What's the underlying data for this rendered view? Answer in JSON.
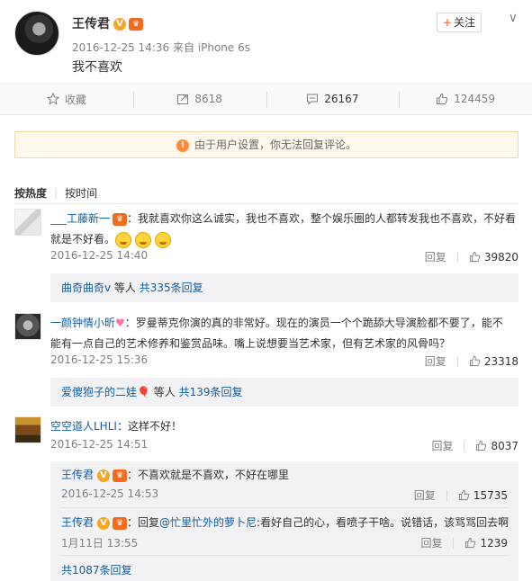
{
  "post": {
    "author": "王传君",
    "v_badge": "V",
    "crown_badge": "♛",
    "meta": "2016-12-25 14:36 来自 iPhone 6s",
    "text": "我不喜欢",
    "follow_label": "关注",
    "follow_plus": "+",
    "chevron": "∨"
  },
  "actions": {
    "favorite": "收藏",
    "forward": "8618",
    "comment": "26167",
    "like": "124459"
  },
  "notice": {
    "icon": "!",
    "text": "由于用户设置，你无法回复评论。"
  },
  "sort": {
    "hot": "按热度",
    "time": "按时间"
  },
  "comments": [
    {
      "user": "___工藤新一",
      "text_line1": "：我就喜欢你这么诚实，我也不喜欢，整个娱乐圈的人都转发我也不喜欢，不好看",
      "text_line2": "就是不好看。",
      "time": "2016-12-25 14:40",
      "reply": "回复",
      "likes": "39820",
      "sub_user": "曲奇曲奇v",
      "sub_mid": " 等人 ",
      "sub_count": "共335条回复"
    },
    {
      "user": "一颜钟情小昕",
      "text_line1": "：罗曼蒂克你演的真的非常好。现在的演员一个个跪舔大导演脸都不要了，能不",
      "text_line2": "能有一点自己的艺术修养和鉴赏品味。嘴上说想要当艺术家，但有艺术家的风骨吗？",
      "time": "2016-12-25 15:36",
      "reply": "回复",
      "likes": "23318",
      "sub_user": "爱傻狍子的二娃",
      "sub_mid": " 等人 ",
      "sub_count": "共139条回复"
    },
    {
      "user": "空空道人LHLI",
      "text_line1": "：这样不好！",
      "time": "2016-12-25 14:51",
      "reply": "回复",
      "likes": "8037",
      "replies": [
        {
          "user": "王传君",
          "text": "：不喜欢就是不喜欢，不好在哪里",
          "time": "2016-12-25 14:53",
          "reply": "回复",
          "likes": "15735"
        },
        {
          "user": "王传君",
          "prefix": "：回复",
          "mention": "@忙里忙外的萝卜尼",
          "text": ":看好自己的心，看喷子干啥。说错话，该骂骂回去啊",
          "time": "1月11日 13:55",
          "reply": "回复",
          "likes": "1239"
        }
      ],
      "more": "共1087条回复"
    }
  ]
}
